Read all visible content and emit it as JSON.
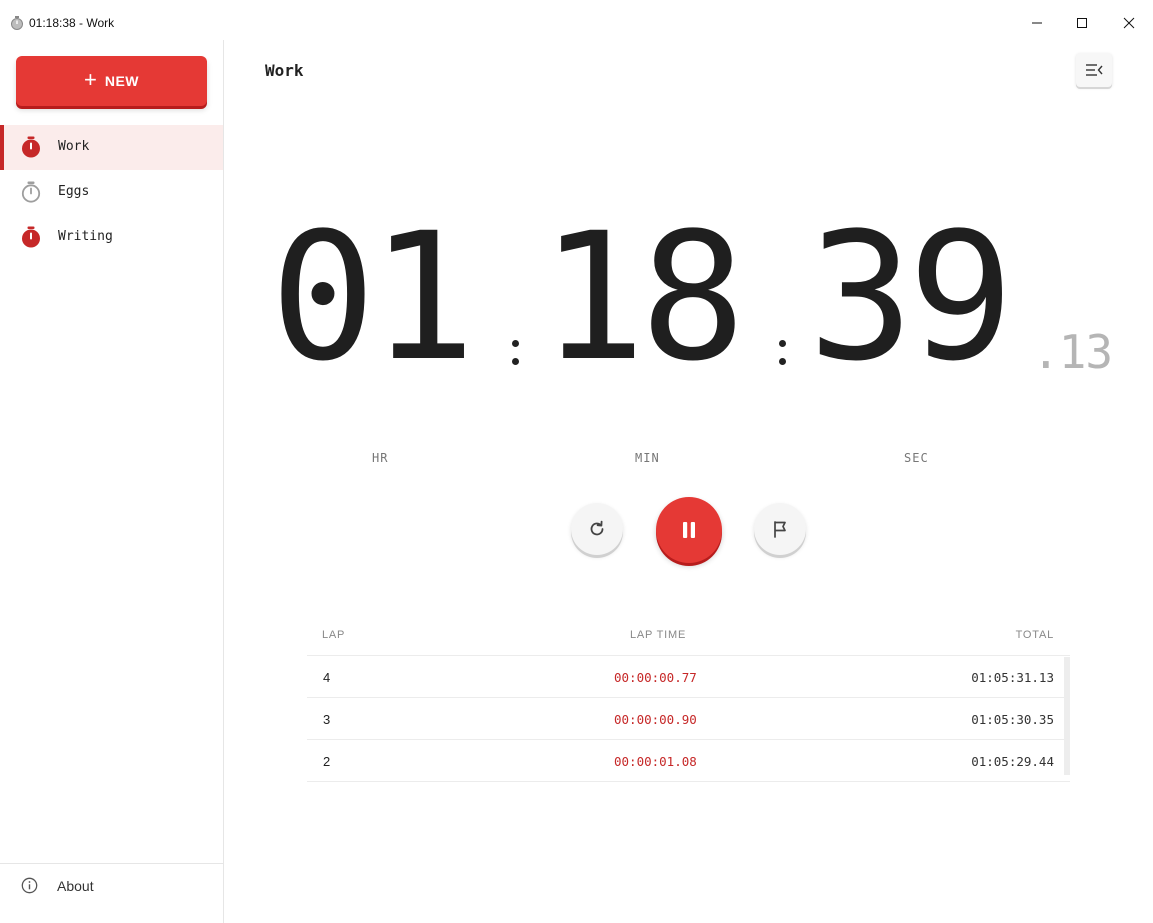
{
  "window": {
    "title": "01:18:38 - Work",
    "icon": "stopwatch-icon",
    "controls": [
      "minimize-icon",
      "maximize-icon",
      "close-icon"
    ]
  },
  "sidebar": {
    "new_button": {
      "icon": "plus-icon",
      "plus": "+",
      "label": "NEW"
    },
    "items": [
      {
        "label": "Work",
        "icon": "stopwatch-running-icon",
        "active": true,
        "color": "#c62828"
      },
      {
        "label": "Eggs",
        "icon": "stopwatch-idle-icon",
        "active": false,
        "color": "#9e9e9e"
      },
      {
        "label": "Writing",
        "icon": "stopwatch-running-icon",
        "active": false,
        "color": "#c62828"
      }
    ],
    "footer": {
      "label": "About",
      "icon": "info-icon"
    }
  },
  "main": {
    "title": "Work",
    "collapse_icon": "collapse-menu-icon",
    "timer": {
      "hours": "01",
      "minutes": "18",
      "seconds": "39",
      "fraction": ".13",
      "units": {
        "hours": "HR",
        "minutes": "MIN",
        "seconds": "SEC"
      }
    },
    "controls": {
      "reset_icon": "reset-icon",
      "pause_icon": "pause-icon",
      "lap_icon": "flag-icon"
    },
    "laps": {
      "headers": {
        "lap": "LAP",
        "lap_time": "LAP TIME",
        "total": "TOTAL"
      },
      "rows": [
        {
          "lap": "4",
          "lap_time": "00:00:00.77",
          "total": "01:05:31.13"
        },
        {
          "lap": "3",
          "lap_time": "00:00:00.90",
          "total": "01:05:30.35"
        },
        {
          "lap": "2",
          "lap_time": "00:00:01.08",
          "total": "01:05:29.44"
        }
      ]
    }
  },
  "colors": {
    "accent": "#e53935",
    "accent_dark": "#c62828",
    "active_row_bg": "#fbeceb",
    "fraction_gray": "#b5b5b5"
  }
}
